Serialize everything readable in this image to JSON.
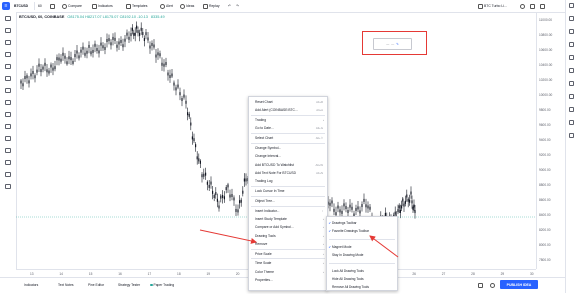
{
  "toolbar": {
    "symbol": "BTCUSD",
    "interval": "60",
    "items": [
      "Compare",
      "Indicators",
      "Templates",
      "Alert",
      "Ideas",
      "Replay"
    ],
    "saved_layout": "BTC Turbo Li..."
  },
  "legend": {
    "title": "BTC/USD, 60, COINBASE",
    "ohlc": "O8175.04 H8217.07 L8175.07 C8192.10 -10.13",
    "volume_value": "8335.49"
  },
  "price_axis": {
    "labels": [
      "11000.00",
      "10800.00",
      "10600.00",
      "10400.00",
      "10200.00",
      "10000.00",
      "9800.00",
      "9600.00",
      "9400.00",
      "9200.00",
      "9000.00",
      "8800.00",
      "8600.00",
      "8400.00",
      "8200.00",
      "8000.00",
      "7800.00"
    ]
  },
  "time_axis": {
    "labels": [
      "13",
      "14",
      "15",
      "16",
      "17",
      "18",
      "19",
      "20",
      "21",
      "22",
      "23",
      "24",
      "25",
      "26",
      "27",
      "28",
      "29",
      "30"
    ]
  },
  "bottom_bar": {
    "tabs": [
      "Indicators",
      "Text Notes",
      "Pine Editor",
      "Strategy Tester",
      "Paper Trading"
    ],
    "publish_label": "PUBLISH IDEA"
  },
  "floating_toolbar": {
    "items": [
      "—",
      "---",
      "✎"
    ]
  },
  "context_menu": {
    "items": [
      {
        "label": "Reset Chart",
        "shortcut": "Alt+R"
      },
      {
        "label": "Add Alert (COINBASE:BTC...",
        "shortcut": "Alt+A"
      },
      {
        "label": "Trading",
        "shortcut": ""
      },
      {
        "label": "Go to Date...",
        "shortcut": "Alt+G"
      },
      {
        "label": "Select Chart",
        "shortcut": "Alt+⇧"
      },
      {
        "label": "Change Symbol...",
        "shortcut": ""
      },
      {
        "label": "Change Interval...",
        "shortcut": ""
      },
      {
        "label": "Add BTCUSD To Watchlist",
        "shortcut": "Alt+W"
      },
      {
        "label": "Add Text Note For BTCUSD",
        "shortcut": "Alt+N"
      },
      {
        "label": "Trading Log",
        "shortcut": ""
      },
      {
        "label": "Lock Cursor In Time",
        "shortcut": ""
      },
      {
        "label": "Object Tree...",
        "shortcut": ""
      },
      {
        "label": "Insert Indicator...",
        "shortcut": "/"
      },
      {
        "label": "Insert Study Template",
        "shortcut": ""
      },
      {
        "label": "Compare or Add Symbol...",
        "shortcut": ""
      },
      {
        "label": "Drawing Tools",
        "shortcut": ""
      },
      {
        "label": "Remove",
        "shortcut": ""
      },
      {
        "label": "Price Scale",
        "shortcut": ""
      },
      {
        "label": "Time Scale",
        "shortcut": ""
      },
      {
        "label": "Color Theme",
        "shortcut": ""
      },
      {
        "label": "Properties...",
        "shortcut": ""
      }
    ]
  },
  "submenu": {
    "items": [
      {
        "label": "Drawings Toolbar",
        "checked": true
      },
      {
        "label": "Favorite Drawings Toolbar",
        "checked": true
      },
      {
        "label": "Magnet Mode",
        "checked": true
      },
      {
        "label": "Stay In Drawing Mode",
        "checked": false
      },
      {
        "label": "Lock All Drawing Tools",
        "checked": false
      },
      {
        "label": "Hide All Drawing Tools",
        "checked": false
      },
      {
        "label": "Remove All Drawing Tools",
        "checked": false
      }
    ]
  },
  "colors": {
    "accent": "#2962ff",
    "annotation": "#e53935",
    "candle": "#131722"
  }
}
